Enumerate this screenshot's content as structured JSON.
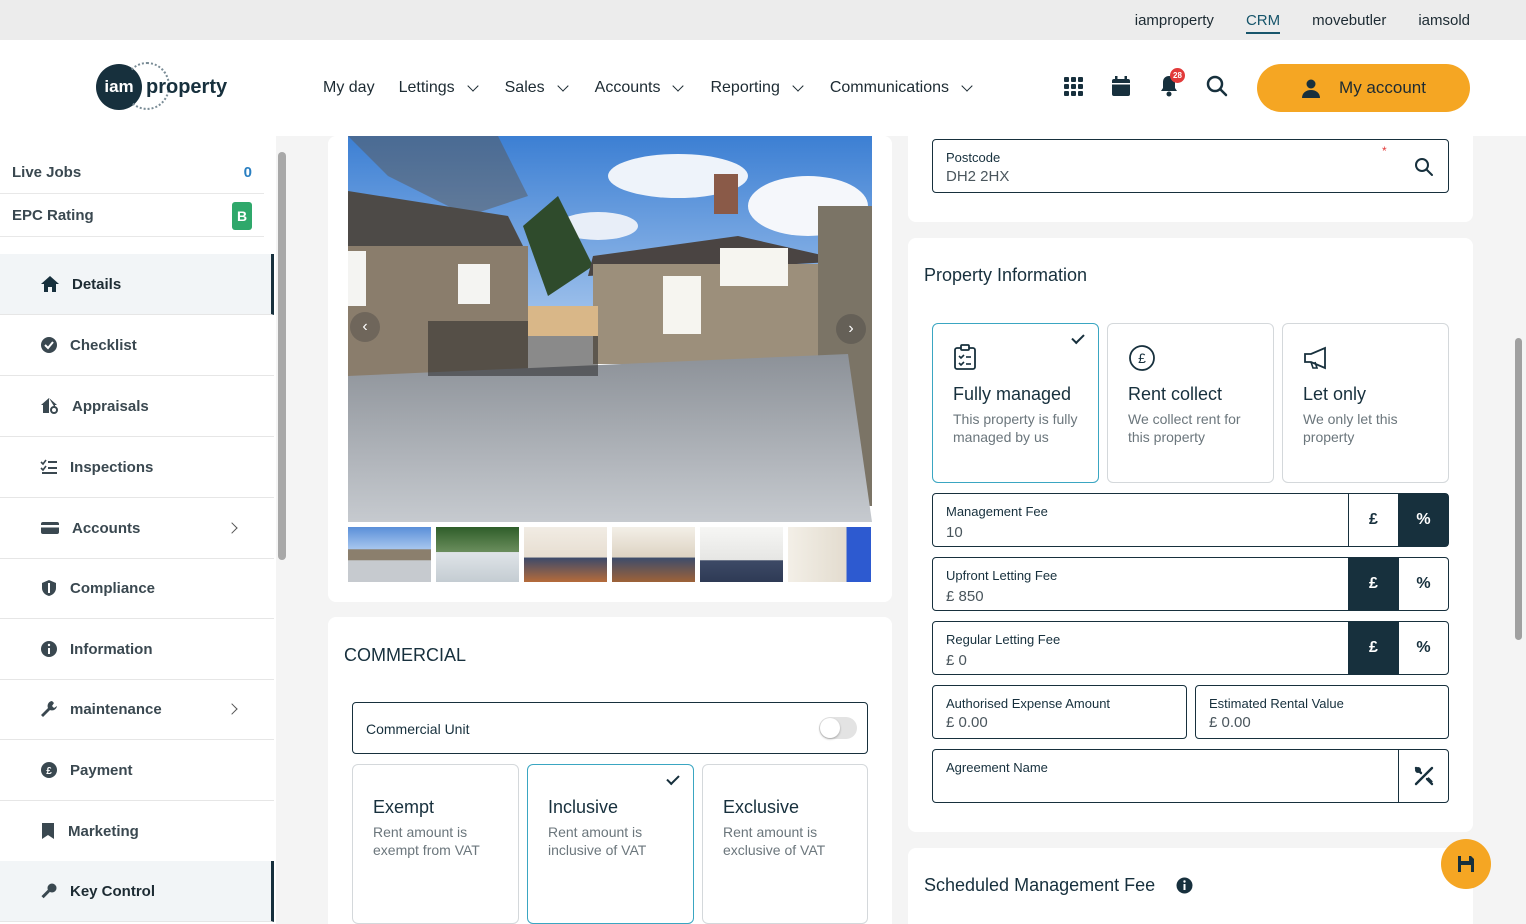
{
  "topbar": {
    "brands": [
      "iamproperty",
      "CRM",
      "movebutler",
      "iamsold"
    ],
    "active_brand": "CRM"
  },
  "header": {
    "logo": {
      "circle_text": "iam",
      "word": "property"
    },
    "nav": [
      "My day",
      "Lettings",
      "Sales",
      "Accounts",
      "Reporting",
      "Communications"
    ],
    "notification_count": "28",
    "my_account_label": "My account",
    "accent_color": "#f5a623"
  },
  "sidebar": {
    "stats": [
      {
        "label": "Live Jobs",
        "value": "0"
      },
      {
        "label": "EPC Rating",
        "value": "B"
      }
    ],
    "items": [
      {
        "label": "Details",
        "icon": "home-icon"
      },
      {
        "label": "Checklist",
        "icon": "check-circle-icon"
      },
      {
        "label": "Appraisals",
        "icon": "house-search-icon"
      },
      {
        "label": "Inspections",
        "icon": "checklist-icon"
      },
      {
        "label": "Accounts",
        "icon": "card-icon"
      },
      {
        "label": "Compliance",
        "icon": "shield-icon"
      },
      {
        "label": "Information",
        "icon": "info-icon"
      },
      {
        "label": "maintenance",
        "icon": "wrench-icon"
      },
      {
        "label": "Payment",
        "icon": "pound-icon"
      },
      {
        "label": "Marketing",
        "icon": "bookmark-icon"
      },
      {
        "label": "Key Control",
        "icon": "key-icon"
      }
    ]
  },
  "commercial": {
    "title": "COMMERCIAL",
    "unit_label": "Commercial Unit",
    "options": [
      {
        "title": "Exempt",
        "desc": "Rent amount is exempt from VAT"
      },
      {
        "title": "Inclusive",
        "desc": "Rent amount is inclusive of VAT"
      },
      {
        "title": "Exclusive",
        "desc": "Rent amount is exclusive of VAT"
      }
    ]
  },
  "address": {
    "postcode_label": "Postcode",
    "postcode_value": "DH2 2HX"
  },
  "property_info": {
    "title": "Property Information",
    "types": [
      {
        "title": "Fully managed",
        "desc": "This property is fully managed by us"
      },
      {
        "title": "Rent collect",
        "desc": "We collect rent for this property"
      },
      {
        "title": "Let only",
        "desc": "We only let this property"
      }
    ],
    "management_fee": {
      "label": "Management Fee",
      "value": "10"
    },
    "upfront_fee": {
      "label": "Upfront Letting Fee",
      "value": "£ 850"
    },
    "regular_fee": {
      "label": "Regular Letting Fee",
      "value": "£ 0"
    },
    "authorised_expense": {
      "label": "Authorised Expense Amount",
      "value": "£ 0.00"
    },
    "estimated_rent": {
      "label": "Estimated Rental Value",
      "value": "£ 0.00"
    },
    "agreement_name": {
      "label": "Agreement Name",
      "value": ""
    },
    "unit_pound": "£",
    "unit_percent": "%"
  },
  "scheduled": {
    "title": "Scheduled Management Fee"
  }
}
